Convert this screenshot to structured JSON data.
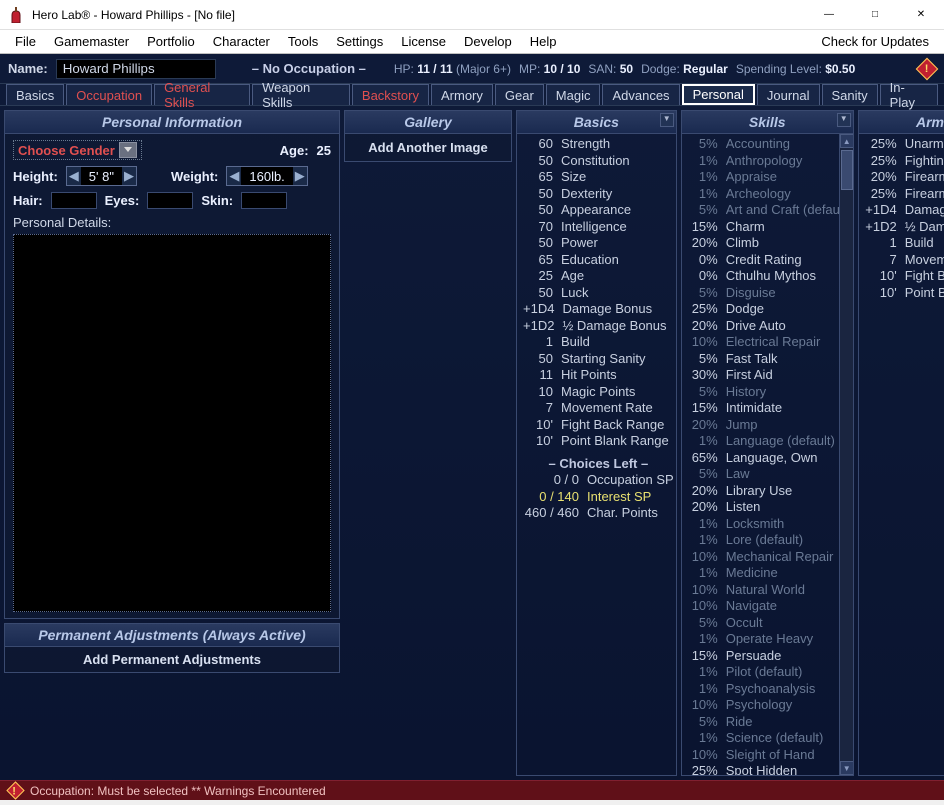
{
  "window": {
    "title": "Hero Lab®  -  Howard Phillips  -  [No file]",
    "updates": "Check for Updates"
  },
  "menu": [
    "File",
    "Gamemaster",
    "Portfolio",
    "Character",
    "Tools",
    "Settings",
    "License",
    "Develop",
    "Help"
  ],
  "header": {
    "name_label": "Name:",
    "name_value": "Howard Phillips",
    "occupation": "– No Occupation –",
    "hp_label": "HP:",
    "hp_value": "11 / 11",
    "hp_note": "(Major 6+)",
    "mp_label": "MP:",
    "mp_value": "10 / 10",
    "san_label": "SAN:",
    "san_value": "50",
    "dodge_label": "Dodge:",
    "dodge_value": "Regular",
    "spend_label": "Spending Level:",
    "spend_value": "$0.50"
  },
  "tabs": [
    {
      "label": "Basics",
      "red": false
    },
    {
      "label": "Occupation",
      "red": true
    },
    {
      "label": "General Skills",
      "red": true
    },
    {
      "label": "Weapon Skills",
      "red": false
    },
    {
      "label": "Backstory",
      "red": true
    },
    {
      "label": "Armory",
      "red": false
    },
    {
      "label": "Gear",
      "red": false
    },
    {
      "label": "Magic",
      "red": false
    },
    {
      "label": "Advances",
      "red": false
    },
    {
      "label": "Personal",
      "red": false,
      "active": true
    },
    {
      "label": "Journal",
      "red": false
    },
    {
      "label": "Sanity",
      "red": false
    },
    {
      "label": "In-Play",
      "red": false
    }
  ],
  "personal": {
    "header": "Personal Information",
    "choose_gender": "Choose Gender",
    "age_label": "Age:",
    "age_value": "25",
    "height_label": "Height:",
    "height_value": "5' 8\"",
    "weight_label": "Weight:",
    "weight_value": "160lb.",
    "hair_label": "Hair:",
    "eyes_label": "Eyes:",
    "skin_label": "Skin:",
    "details_label": "Personal Details:"
  },
  "permanent": {
    "header": "Permanent Adjustments (Always Active)",
    "button": "Add Permanent Adjustments"
  },
  "gallery": {
    "header": "Gallery",
    "button": "Add Another Image"
  },
  "basics_panel": {
    "header": "Basics",
    "rows": [
      {
        "v": "60",
        "n": "Strength"
      },
      {
        "v": "50",
        "n": "Constitution"
      },
      {
        "v": "65",
        "n": "Size"
      },
      {
        "v": "50",
        "n": "Dexterity"
      },
      {
        "v": "50",
        "n": "Appearance"
      },
      {
        "v": "70",
        "n": "Intelligence"
      },
      {
        "v": "50",
        "n": "Power"
      },
      {
        "v": "65",
        "n": "Education"
      },
      {
        "v": "",
        "n": ""
      },
      {
        "v": "25",
        "n": "Age"
      },
      {
        "v": "50",
        "n": "Luck"
      },
      {
        "v": "+1D4",
        "n": "Damage Bonus"
      },
      {
        "v": "+1D2",
        "n": "½ Damage Bonus"
      },
      {
        "v": "1",
        "n": "Build"
      },
      {
        "v": "50",
        "n": "Starting Sanity"
      },
      {
        "v": "11",
        "n": "Hit Points"
      },
      {
        "v": "10",
        "n": "Magic Points"
      },
      {
        "v": "7",
        "n": "Movement Rate"
      },
      {
        "v": "10'",
        "n": "Fight Back Range"
      },
      {
        "v": "10'",
        "n": "Point Blank Range"
      }
    ],
    "choices_header": "– Choices Left –",
    "choices": [
      {
        "v": "0 / 0",
        "n": "Occupation SP",
        "cls": ""
      },
      {
        "v": "0 / 140",
        "n": "Interest SP",
        "cls": "yellow"
      },
      {
        "v": "460 / 460",
        "n": "Char. Points",
        "cls": ""
      }
    ]
  },
  "skills_panel": {
    "header": "Skills",
    "rows": [
      {
        "v": "5%",
        "n": "Accounting",
        "dim": true
      },
      {
        "v": "1%",
        "n": "Anthropology",
        "dim": true
      },
      {
        "v": "1%",
        "n": "Appraise",
        "dim": true
      },
      {
        "v": "1%",
        "n": "Archeology",
        "dim": true
      },
      {
        "v": "5%",
        "n": "Art and Craft (default)",
        "dim": true
      },
      {
        "v": "15%",
        "n": "Charm"
      },
      {
        "v": "20%",
        "n": "Climb"
      },
      {
        "v": "0%",
        "n": "Credit Rating"
      },
      {
        "v": "0%",
        "n": "Cthulhu Mythos"
      },
      {
        "v": "5%",
        "n": "Disguise",
        "dim": true
      },
      {
        "v": "25%",
        "n": "Dodge"
      },
      {
        "v": "20%",
        "n": "Drive Auto"
      },
      {
        "v": "10%",
        "n": "Electrical Repair",
        "dim": true
      },
      {
        "v": "5%",
        "n": "Fast Talk"
      },
      {
        "v": "30%",
        "n": "First Aid"
      },
      {
        "v": "5%",
        "n": "History",
        "dim": true
      },
      {
        "v": "15%",
        "n": "Intimidate"
      },
      {
        "v": "20%",
        "n": "Jump",
        "dim": true
      },
      {
        "v": "1%",
        "n": " Language (default)",
        "dim": true
      },
      {
        "v": "65%",
        "n": "Language, Own"
      },
      {
        "v": "5%",
        "n": "Law",
        "dim": true
      },
      {
        "v": "20%",
        "n": "Library Use"
      },
      {
        "v": "20%",
        "n": "Listen"
      },
      {
        "v": "1%",
        "n": "Locksmith",
        "dim": true
      },
      {
        "v": "1%",
        "n": "Lore (default)",
        "dim": true
      },
      {
        "v": "10%",
        "n": "Mechanical Repair",
        "dim": true
      },
      {
        "v": "1%",
        "n": "Medicine",
        "dim": true
      },
      {
        "v": "10%",
        "n": "Natural World",
        "dim": true
      },
      {
        "v": "10%",
        "n": "Navigate",
        "dim": true
      },
      {
        "v": "5%",
        "n": "Occult",
        "dim": true
      },
      {
        "v": "1%",
        "n": "Operate Heavy",
        "dim": true
      },
      {
        "v": "15%",
        "n": "Persuade"
      },
      {
        "v": "1%",
        "n": "Pilot (default)",
        "dim": true
      },
      {
        "v": "1%",
        "n": "Psychoanalysis",
        "dim": true
      },
      {
        "v": "10%",
        "n": "Psychology",
        "dim": true
      },
      {
        "v": "5%",
        "n": "Ride",
        "dim": true
      },
      {
        "v": "1%",
        "n": "Science (default)",
        "dim": true
      },
      {
        "v": "10%",
        "n": "Sleight of Hand",
        "dim": true
      },
      {
        "v": "25%",
        "n": "Spot Hidden"
      }
    ]
  },
  "armory_panel": {
    "header": "Armory",
    "rows": [
      {
        "v": "25%",
        "n": "Unarmed"
      },
      {
        "v": "",
        "n": ""
      },
      {
        "v": "25%",
        "n": "Fighting (Brawl)"
      },
      {
        "v": "20%",
        "n": "Firearms (Handgun)"
      },
      {
        "v": "25%",
        "n": "Firearms (Rifle)"
      },
      {
        "v": "",
        "n": ""
      },
      {
        "v": "+1D4",
        "n": "Damage Bonus"
      },
      {
        "v": "+1D2",
        "n": "½ Damage Bonus"
      },
      {
        "v": "1",
        "n": "Build"
      },
      {
        "v": "7",
        "n": "Movement Rate"
      },
      {
        "v": "10'",
        "n": "Fight Back Range"
      },
      {
        "v": "10'",
        "n": "Point Blank Range"
      }
    ]
  },
  "status": {
    "text": "Occupation: Must be selected ** Warnings Encountered"
  }
}
